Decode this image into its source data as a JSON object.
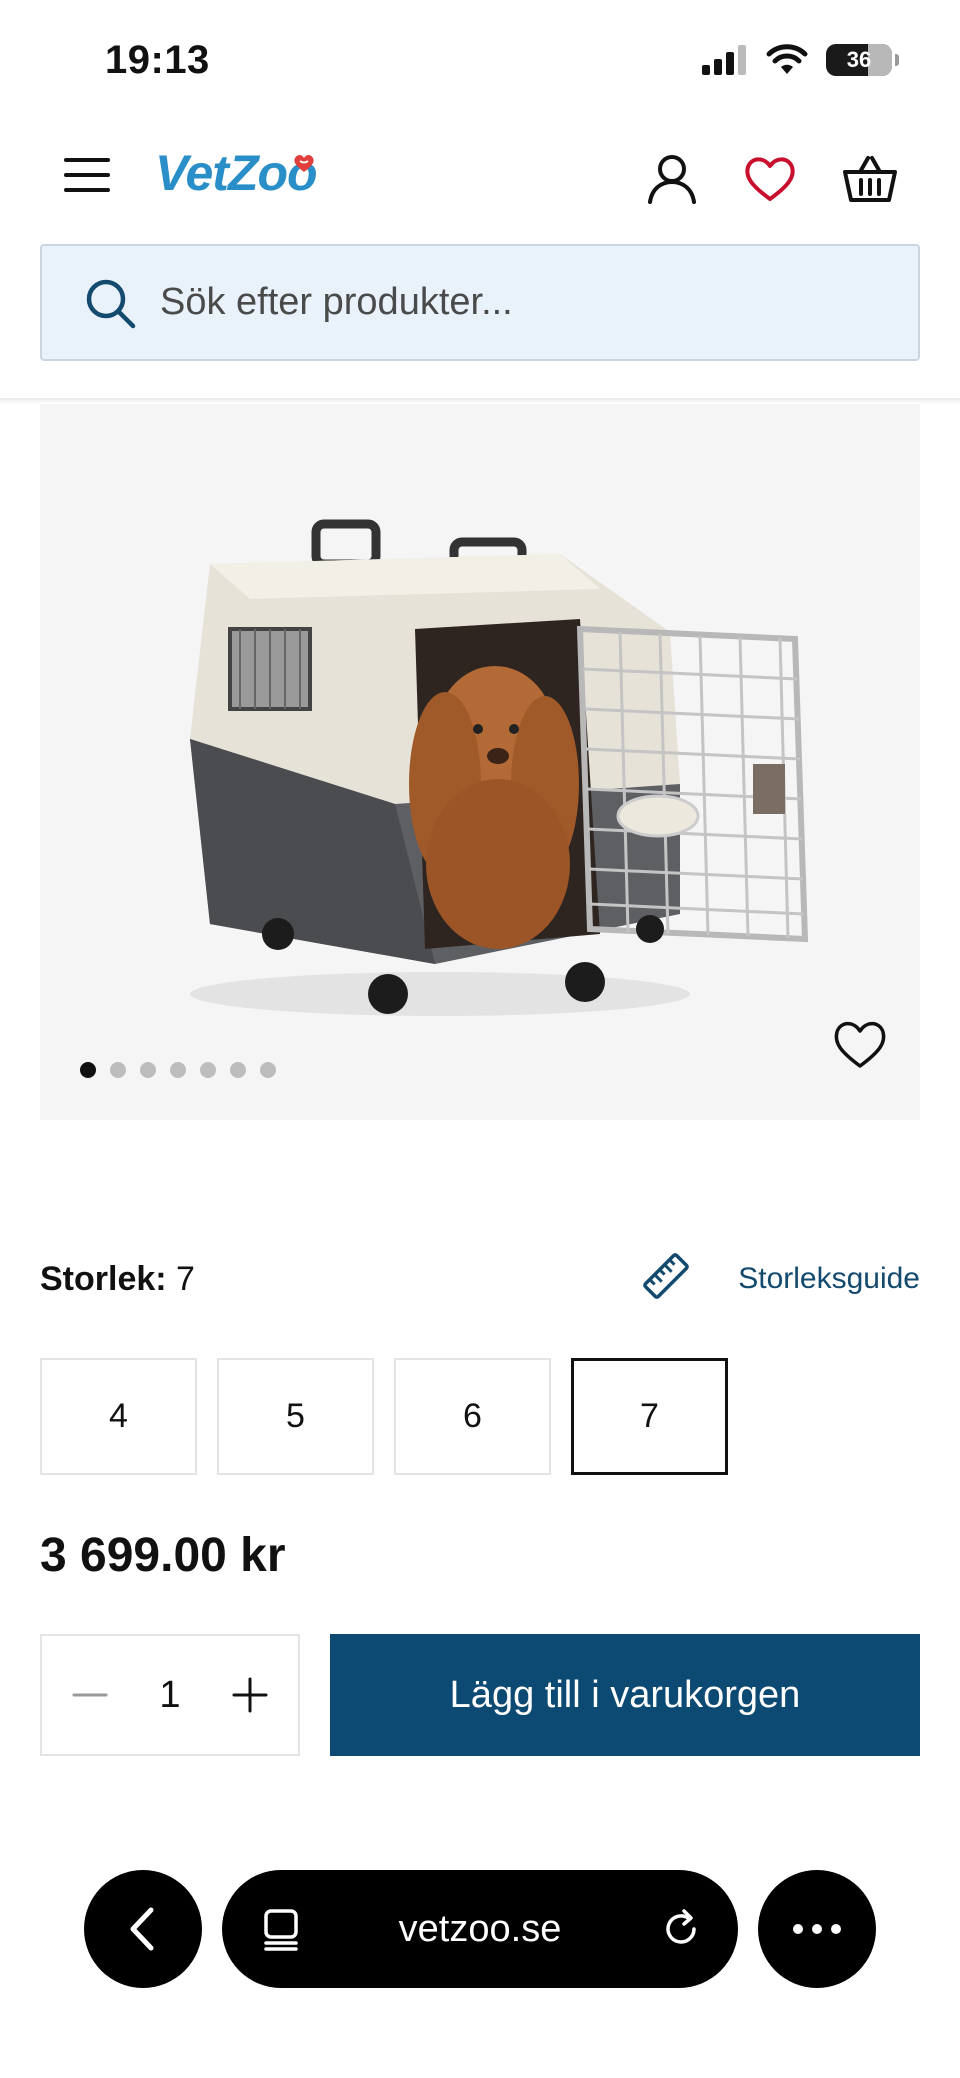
{
  "status_bar": {
    "time": "19:13",
    "battery": "36",
    "battery_level": 0.36
  },
  "header": {
    "logo": "VetZoo",
    "icons": [
      "menu-icon",
      "account-icon",
      "favorites-heart-icon",
      "basket-icon"
    ]
  },
  "search": {
    "placeholder": "Sök efter produkter..."
  },
  "product": {
    "image_count": 7,
    "active_image": 1,
    "size_label": "Storlek:",
    "selected_size": "7",
    "size_guide": "Storleksguide",
    "sizes": [
      "4",
      "5",
      "6",
      "7"
    ],
    "price": "3 699.00 kr",
    "quantity": "1",
    "add_to_cart": "Lägg till i varukorgen"
  },
  "browser": {
    "url": "vetzoo.se"
  },
  "colors": {
    "brand_blue": "#2a8fc8",
    "heart_red": "#c8102e",
    "button_navy": "#0d4a73",
    "search_bg": "#e9f2fb"
  }
}
